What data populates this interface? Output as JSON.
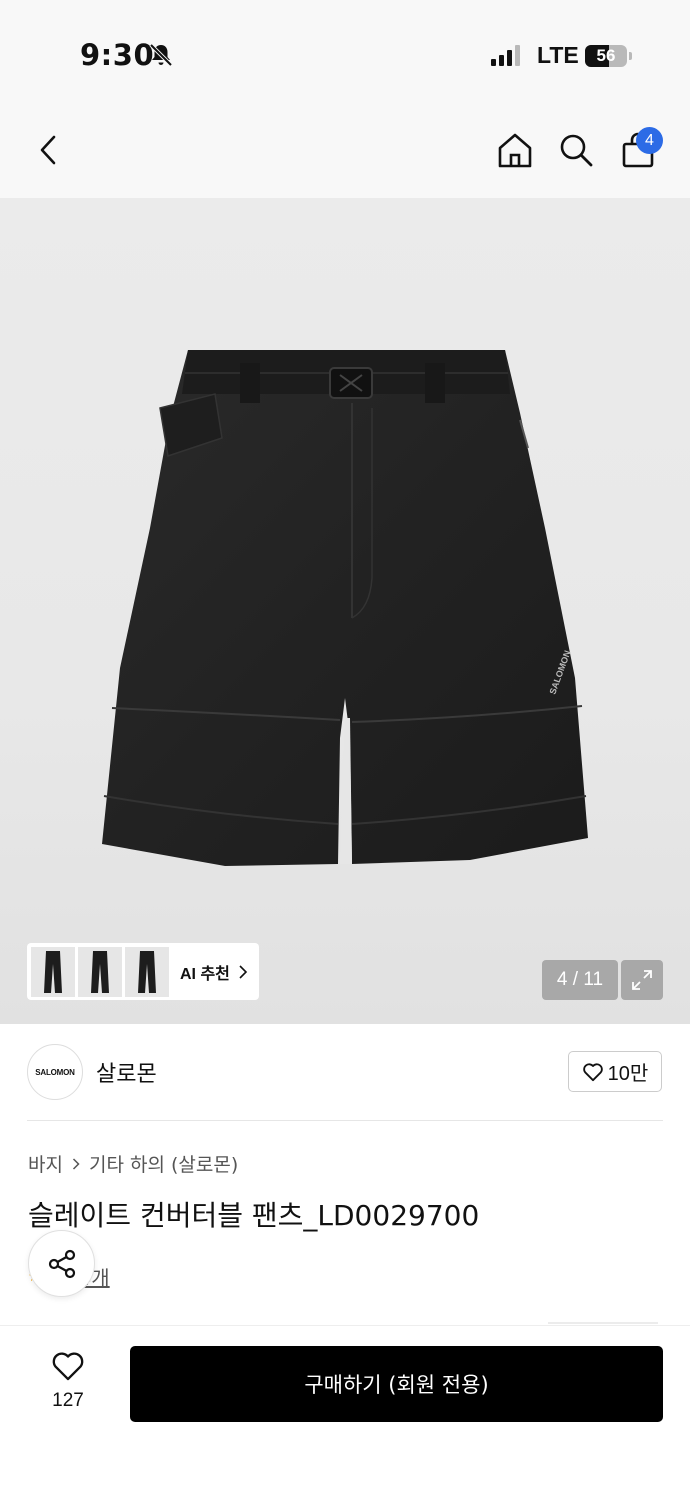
{
  "status_bar": {
    "time": "9:30",
    "network": "LTE",
    "battery": "56",
    "battery_level": 0.56
  },
  "nav": {
    "cart_count": "4",
    "icons": [
      "back-icon",
      "home-icon",
      "search-icon",
      "bag-icon"
    ]
  },
  "gallery": {
    "ai_label": "AI 추천",
    "pager": "4 / 11",
    "product_logo": "SALOMON"
  },
  "brand": {
    "logo_text": "SALOMON",
    "name": "살로몬",
    "likes": "10만"
  },
  "breadcrumb": {
    "category": "바지",
    "subcategory": "기타 하의 (살로몬)"
  },
  "product": {
    "title": "슬레이트 컨버터블 팬츠_LD0029700",
    "review_text": "-기 4개"
  },
  "bottom_bar": {
    "wish_count": "127",
    "buy_label": "구매하기 (회원 전용)"
  },
  "colors": {
    "accent": "#2c6be6",
    "buy_button": "#000000"
  }
}
